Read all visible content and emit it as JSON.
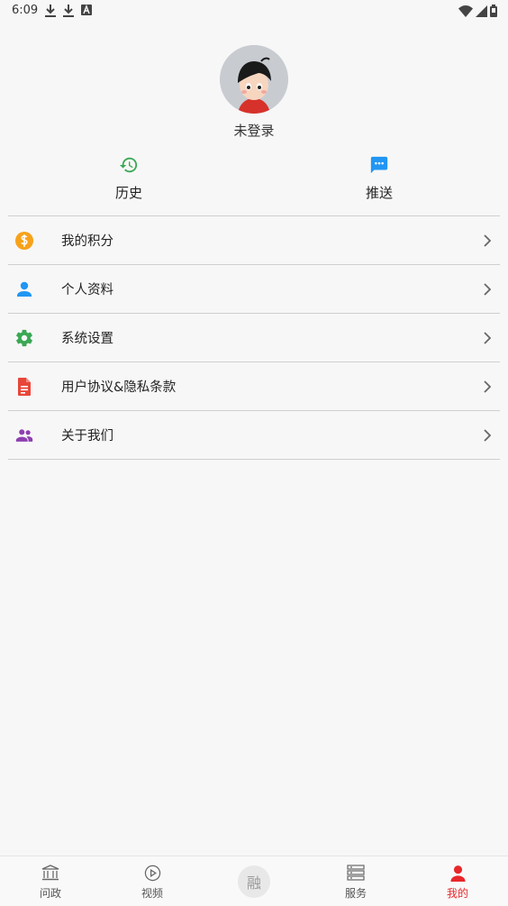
{
  "status_bar": {
    "time": "6:09",
    "left_icons": [
      "download-icon",
      "download-icon",
      "font-icon"
    ],
    "right_icons": [
      "wifi-icon",
      "signal-icon",
      "battery-icon"
    ]
  },
  "profile": {
    "name": "未登录"
  },
  "quick_actions": [
    {
      "label": "历史",
      "icon": "history-icon",
      "color": "#3aa854"
    },
    {
      "label": "推送",
      "icon": "message-icon",
      "color": "#2196f3"
    }
  ],
  "menu": [
    {
      "label": "我的积分",
      "icon": "coin-icon",
      "color": "#f7a21b"
    },
    {
      "label": "个人资料",
      "icon": "person-icon",
      "color": "#2196f3"
    },
    {
      "label": "系统设置",
      "icon": "gear-icon",
      "color": "#3aa854"
    },
    {
      "label": "用户协议&隐私条款",
      "icon": "document-icon",
      "color": "#e8463a"
    },
    {
      "label": "关于我们",
      "icon": "group-icon",
      "color": "#8e3fb0"
    }
  ],
  "tabs": [
    {
      "label": "问政",
      "icon": "government-icon",
      "active": false
    },
    {
      "label": "视频",
      "icon": "play-icon",
      "active": false
    },
    {
      "label": "融",
      "icon": "center-badge",
      "active": false
    },
    {
      "label": "服务",
      "icon": "list-icon",
      "active": false
    },
    {
      "label": "我的",
      "icon": "person-icon",
      "active": true
    }
  ],
  "colors": {
    "background": "#f7f7f7",
    "divider": "#cfcfcf",
    "active_tab": "#e8272b"
  }
}
